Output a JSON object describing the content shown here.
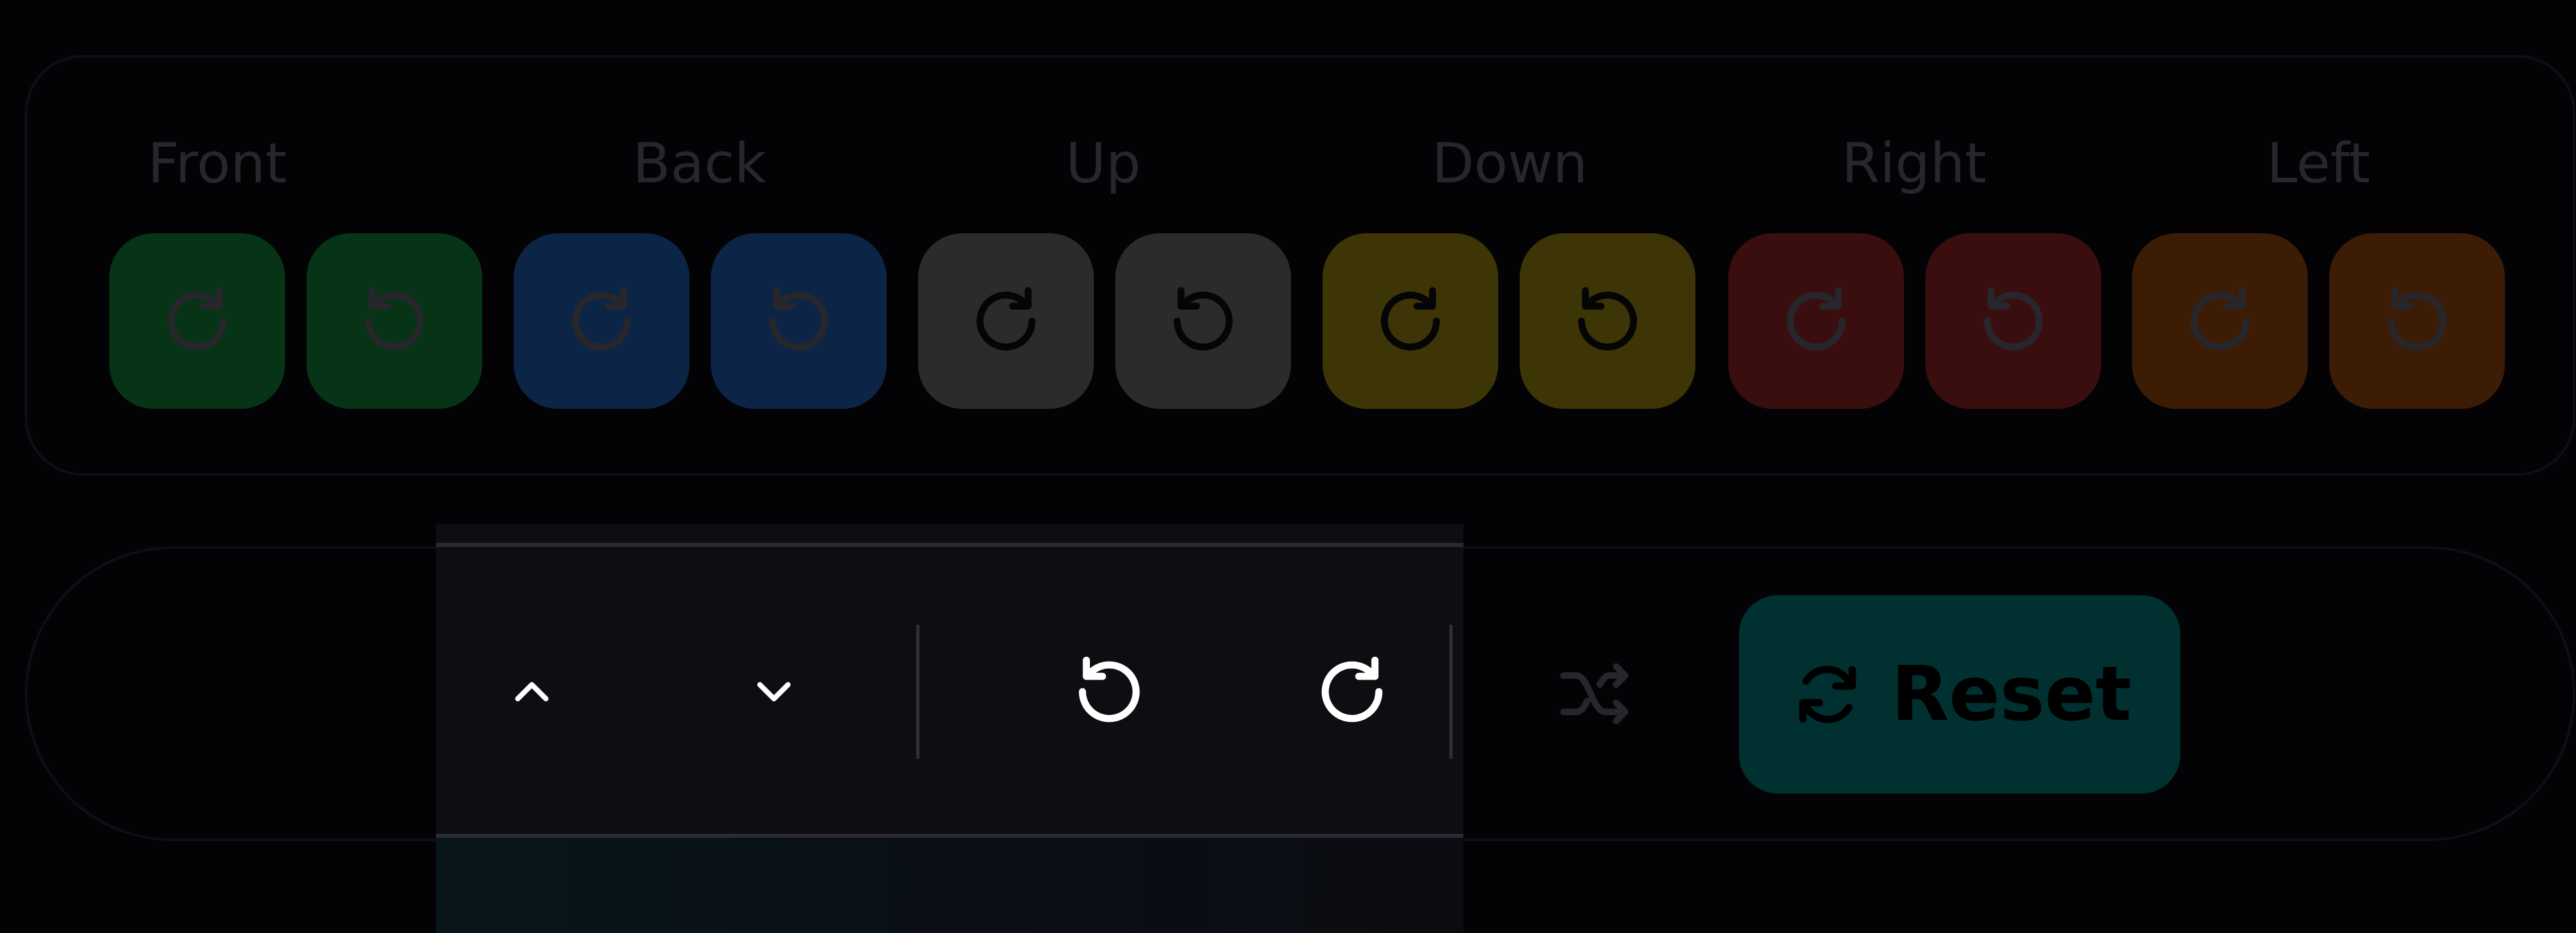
{
  "faces": [
    {
      "label": "Front",
      "color": "#073316"
    },
    {
      "label": "Back",
      "color": "#0c2446"
    },
    {
      "label": "Up",
      "color": "#2b2b2e"
    },
    {
      "label": "Down",
      "color": "#3d3506"
    },
    {
      "label": "Right",
      "color": "#3a0e0f"
    },
    {
      "label": "Left",
      "color": "#3d1c05"
    }
  ],
  "rotate_buttons": [
    "clockwise-icon",
    "counterclockwise-icon"
  ],
  "toolbar": {
    "icons": [
      "chevron-up-icon",
      "chevron-down-icon",
      "undo-icon",
      "redo-icon"
    ]
  },
  "shuffle": {
    "icon": "shuffle-icon"
  },
  "reset": {
    "label": "Reset",
    "icon": "refresh-icon",
    "color": "#00302f"
  }
}
